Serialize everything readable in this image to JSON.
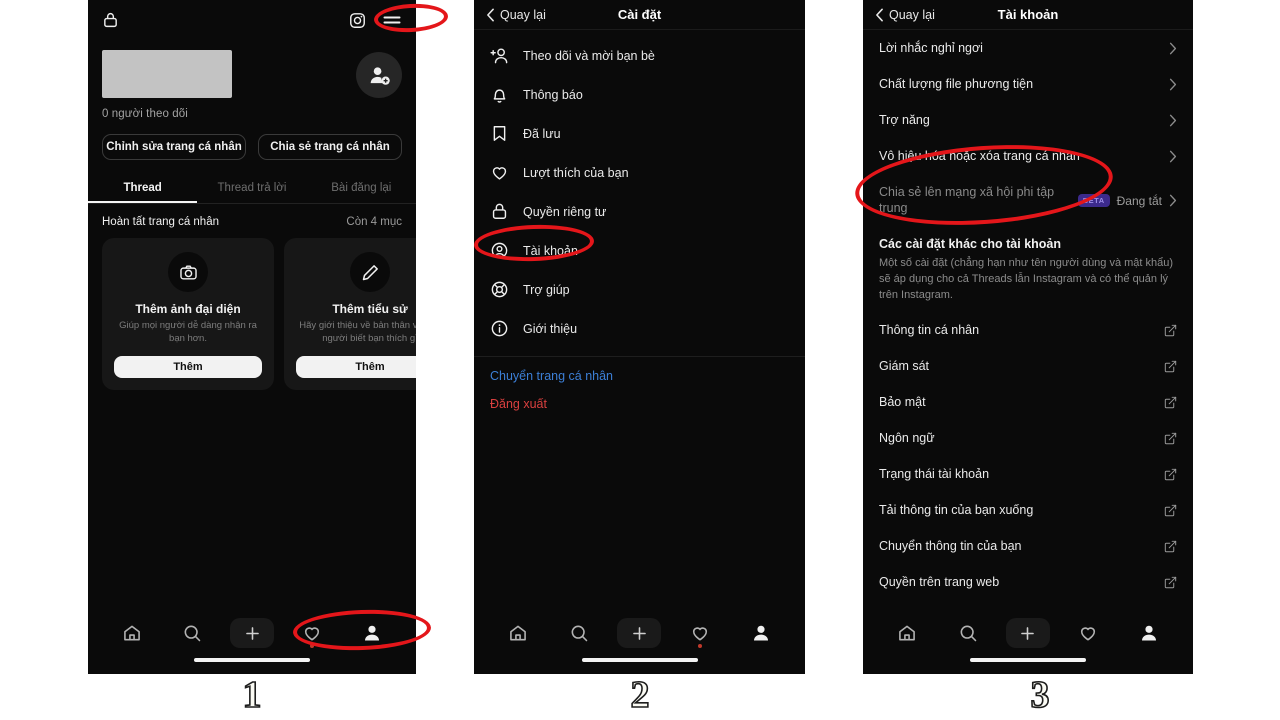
{
  "panel1": {
    "name": "threads-profile-screen",
    "topbar": {
      "lock_icon": "lock-icon",
      "instagram_icon": "instagram-icon",
      "menu_icon": "hamburger-menu-icon"
    },
    "profile": {
      "name_redacted": "",
      "followers": "0 người theo dõi",
      "add_user_icon": "add-person-icon"
    },
    "buttons": {
      "edit_profile": "Chỉnh sửa trang cá nhân",
      "share_profile": "Chia sẻ trang cá nhân"
    },
    "tabs": [
      {
        "label": "Thread",
        "active": true
      },
      {
        "label": "Thread trả lời",
        "active": false
      },
      {
        "label": "Bài đăng lại",
        "active": false
      }
    ],
    "complete_profile": {
      "title": "Hoàn tất trang cá nhân",
      "count": "Còn 4 mục"
    },
    "cards": [
      {
        "icon": "camera-icon",
        "title": "Thêm ảnh đại diện",
        "subtitle": "Giúp mọi người dễ dàng nhận ra bạn hơn.",
        "button": "Thêm"
      },
      {
        "icon": "pencil-icon",
        "title": "Thêm tiểu sử",
        "subtitle": "Hãy giới thiệu về bản thân và mọi người biết bạn thích gì",
        "button": "Thêm"
      }
    ]
  },
  "panel2": {
    "name": "settings-screen",
    "header": {
      "back": "Quay lại",
      "title": "Cài đặt"
    },
    "items": [
      {
        "icon": "follow-invite-icon",
        "label": "Theo dõi và mời bạn bè"
      },
      {
        "icon": "bell-icon",
        "label": "Thông báo"
      },
      {
        "icon": "bookmark-icon",
        "label": "Đã lưu"
      },
      {
        "icon": "heart-icon",
        "label": "Lượt thích của bạn"
      },
      {
        "icon": "lock-icon",
        "label": "Quyền riêng tư"
      },
      {
        "icon": "account-circle-icon",
        "label": "Tài khoản"
      },
      {
        "icon": "lifebuoy-icon",
        "label": "Trợ giúp"
      },
      {
        "icon": "info-icon",
        "label": "Giới thiệu"
      }
    ],
    "switch_profile": "Chuyển trang cá nhân",
    "logout": "Đăng xuất"
  },
  "panel3": {
    "name": "account-settings-screen",
    "header": {
      "back": "Quay lại",
      "title": "Tài khoản"
    },
    "items": [
      {
        "label": "Lời nhắc nghỉ ngơi",
        "chevron": true
      },
      {
        "label": "Chất lượng file phương tiện",
        "chevron": true
      },
      {
        "label": "Trợ năng",
        "chevron": true
      },
      {
        "label": "Vô hiệu hóa hoặc xóa trang cá nhân",
        "chevron": true
      },
      {
        "label": "Chia sẻ lên mạng xã hội phi tập trung",
        "badge": "BETA",
        "state": "Đang tắt",
        "chevron": true,
        "muted": true
      }
    ],
    "section": {
      "title": "Các cài đặt khác cho tài khoản",
      "description": "Một số cài đặt (chẳng hạn như tên người dùng và mật khẩu) sẽ áp dụng cho cả Threads lẫn Instagram và có thể quản lý trên Instagram."
    },
    "external_items": [
      {
        "label": "Thông tin cá nhân",
        "icon": "external-link-icon"
      },
      {
        "label": "Giám sát",
        "icon": "external-link-icon"
      },
      {
        "label": "Bảo mật",
        "icon": "external-link-icon"
      },
      {
        "label": "Ngôn ngữ",
        "icon": "external-link-icon"
      },
      {
        "label": "Trạng thái tài khoản",
        "icon": "external-link-icon"
      },
      {
        "label": "Tải thông tin của bạn xuống",
        "icon": "external-link-icon"
      },
      {
        "label": "Chuyển thông tin của bạn",
        "icon": "external-link-icon"
      },
      {
        "label": "Quyền trên trang web",
        "icon": "external-link-icon"
      }
    ]
  },
  "bottom_nav": {
    "items": [
      {
        "icon": "home-icon",
        "label": "home"
      },
      {
        "icon": "search-icon",
        "label": "search"
      },
      {
        "icon": "plus-icon",
        "label": "create"
      },
      {
        "icon": "heart-icon",
        "label": "activity"
      },
      {
        "icon": "profile-icon",
        "label": "profile"
      }
    ]
  },
  "steps": {
    "one": "1",
    "two": "2",
    "three": "3"
  },
  "colors": {
    "background": "#0a0a0a",
    "annotation": "#e4161a",
    "link": "#3c7fd6",
    "danger": "#d9403f",
    "beta_badge_bg": "#3c2a8c"
  }
}
